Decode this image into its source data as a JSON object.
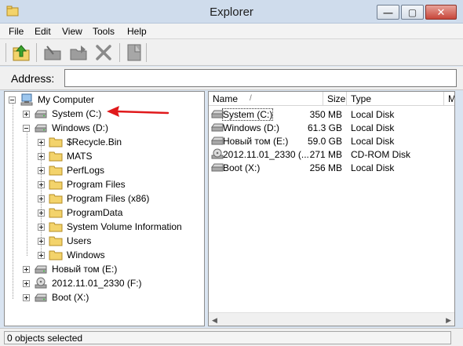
{
  "window": {
    "title": "Explorer"
  },
  "menu": [
    "File",
    "Edit",
    "View",
    "Tools",
    "Help"
  ],
  "toolbar": {
    "buttons": [
      {
        "icon": "up-folder-icon"
      },
      {
        "icon": "cut-folder-icon"
      },
      {
        "icon": "copy-folder-icon"
      },
      {
        "icon": "delete-icon"
      },
      {
        "icon": "properties-icon"
      }
    ]
  },
  "address": {
    "label": "Address:",
    "value": ""
  },
  "tree": {
    "root": "My Computer",
    "system_drive": "System (C:)",
    "windows_drive": "Windows (D:)",
    "windows_folders": [
      "$Recycle.Bin",
      "MATS",
      "PerfLogs",
      "Program Files",
      "Program Files (x86)",
      "ProgramData",
      "System Volume Information",
      "Users",
      "Windows"
    ],
    "drive_e": "Новый том (E:)",
    "drive_f": "2012.11.01_2330 (F:)",
    "drive_x": "Boot (X:)"
  },
  "list": {
    "columns": [
      "Name",
      "Size",
      "Type",
      "M"
    ],
    "sort_glyph": "/",
    "rows": [
      {
        "name": "System (C:)",
        "size": "350 MB",
        "type": "Local Disk",
        "icon": "drive-icon"
      },
      {
        "name": "Windows (D:)",
        "size": "61.3 GB",
        "type": "Local Disk",
        "icon": "drive-icon"
      },
      {
        "name": "Новый том (E:)",
        "size": "59.0 GB",
        "type": "Local Disk",
        "icon": "drive-icon"
      },
      {
        "name": "2012.11.01_2330 (...",
        "size": "271 MB",
        "type": "CD-ROM Disk",
        "icon": "cdrom-icon"
      },
      {
        "name": "Boot (X:)",
        "size": "256 MB",
        "type": "Local Disk",
        "icon": "drive-icon"
      }
    ]
  },
  "status": {
    "text": "0 objects selected"
  },
  "colors": {
    "annotation_arrow": "#e0191b",
    "folder": "#f3d36b",
    "title_bar": "#cfdcec"
  }
}
